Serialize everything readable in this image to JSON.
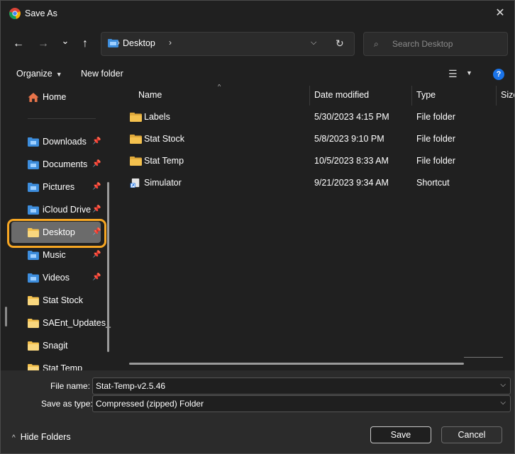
{
  "window": {
    "title": "Save As",
    "close_glyph": "✕"
  },
  "nav": {
    "back_glyph": "←",
    "forward_glyph": "→",
    "recent_glyph": "⌄",
    "up_glyph": "↑",
    "address_crumb": "Desktop",
    "address_sep": "›",
    "address_dropdown": "⌵",
    "refresh_glyph": "↻",
    "search_placeholder": "Search Desktop",
    "search_glyph": "⌕"
  },
  "toolbar": {
    "organize_label": "Organize",
    "organize_caret": "▼",
    "new_folder_label": "New folder",
    "view_glyph": "☰",
    "view_caret": "▼",
    "help_glyph": "?"
  },
  "sidebar": {
    "home_label": "Home",
    "pin_glyph": "📌",
    "items": [
      {
        "label": "Downloads",
        "icon": "downloads-icon",
        "pinned": true
      },
      {
        "label": "Documents",
        "icon": "documents-icon",
        "pinned": true
      },
      {
        "label": "Pictures",
        "icon": "pictures-icon",
        "pinned": true
      },
      {
        "label": "iCloud Drive",
        "icon": "icloud-icon",
        "pinned": true
      },
      {
        "label": "Desktop",
        "icon": "desktop-folder-icon",
        "pinned": true,
        "selected": true
      },
      {
        "label": "Music",
        "icon": "music-icon",
        "pinned": true
      },
      {
        "label": "Videos",
        "icon": "videos-icon",
        "pinned": true
      },
      {
        "label": "Stat Stock",
        "icon": "folder-icon",
        "pinned": false
      },
      {
        "label": "SAEnt_Updates_",
        "icon": "folder-icon",
        "pinned": false
      },
      {
        "label": "Snagit",
        "icon": "folder-icon",
        "pinned": false
      },
      {
        "label": "Stat Temp",
        "icon": "folder-icon",
        "pinned": false
      }
    ]
  },
  "columns": {
    "name": "Name",
    "date": "Date modified",
    "type": "Type",
    "size": "Size",
    "sort_glyph": "^"
  },
  "files": [
    {
      "name": "Labels",
      "date": "5/30/2023 4:15 PM",
      "type": "File folder",
      "kind": "folder"
    },
    {
      "name": "Stat Stock",
      "date": "5/8/2023 9:10 PM",
      "type": "File folder",
      "kind": "folder"
    },
    {
      "name": "Stat Temp",
      "date": "10/5/2023 8:33 AM",
      "type": "File folder",
      "kind": "folder"
    },
    {
      "name": "Simulator",
      "date": "9/21/2023 9:34 AM",
      "type": "Shortcut",
      "kind": "shortcut"
    }
  ],
  "form": {
    "file_name_label": "File name:",
    "file_name_value": "Stat-Temp-v2.5.46",
    "save_type_label": "Save as type:",
    "save_type_value": "Compressed (zipped) Folder",
    "dropdown_glyph": "⌵"
  },
  "footer": {
    "hide_folders_label": "Hide Folders",
    "hide_folders_chevron": "^",
    "save_label": "Save",
    "cancel_label": "Cancel"
  },
  "colors": {
    "accent": "#f6a623",
    "folder": "#f4c14e",
    "help": "#1a73e8"
  }
}
